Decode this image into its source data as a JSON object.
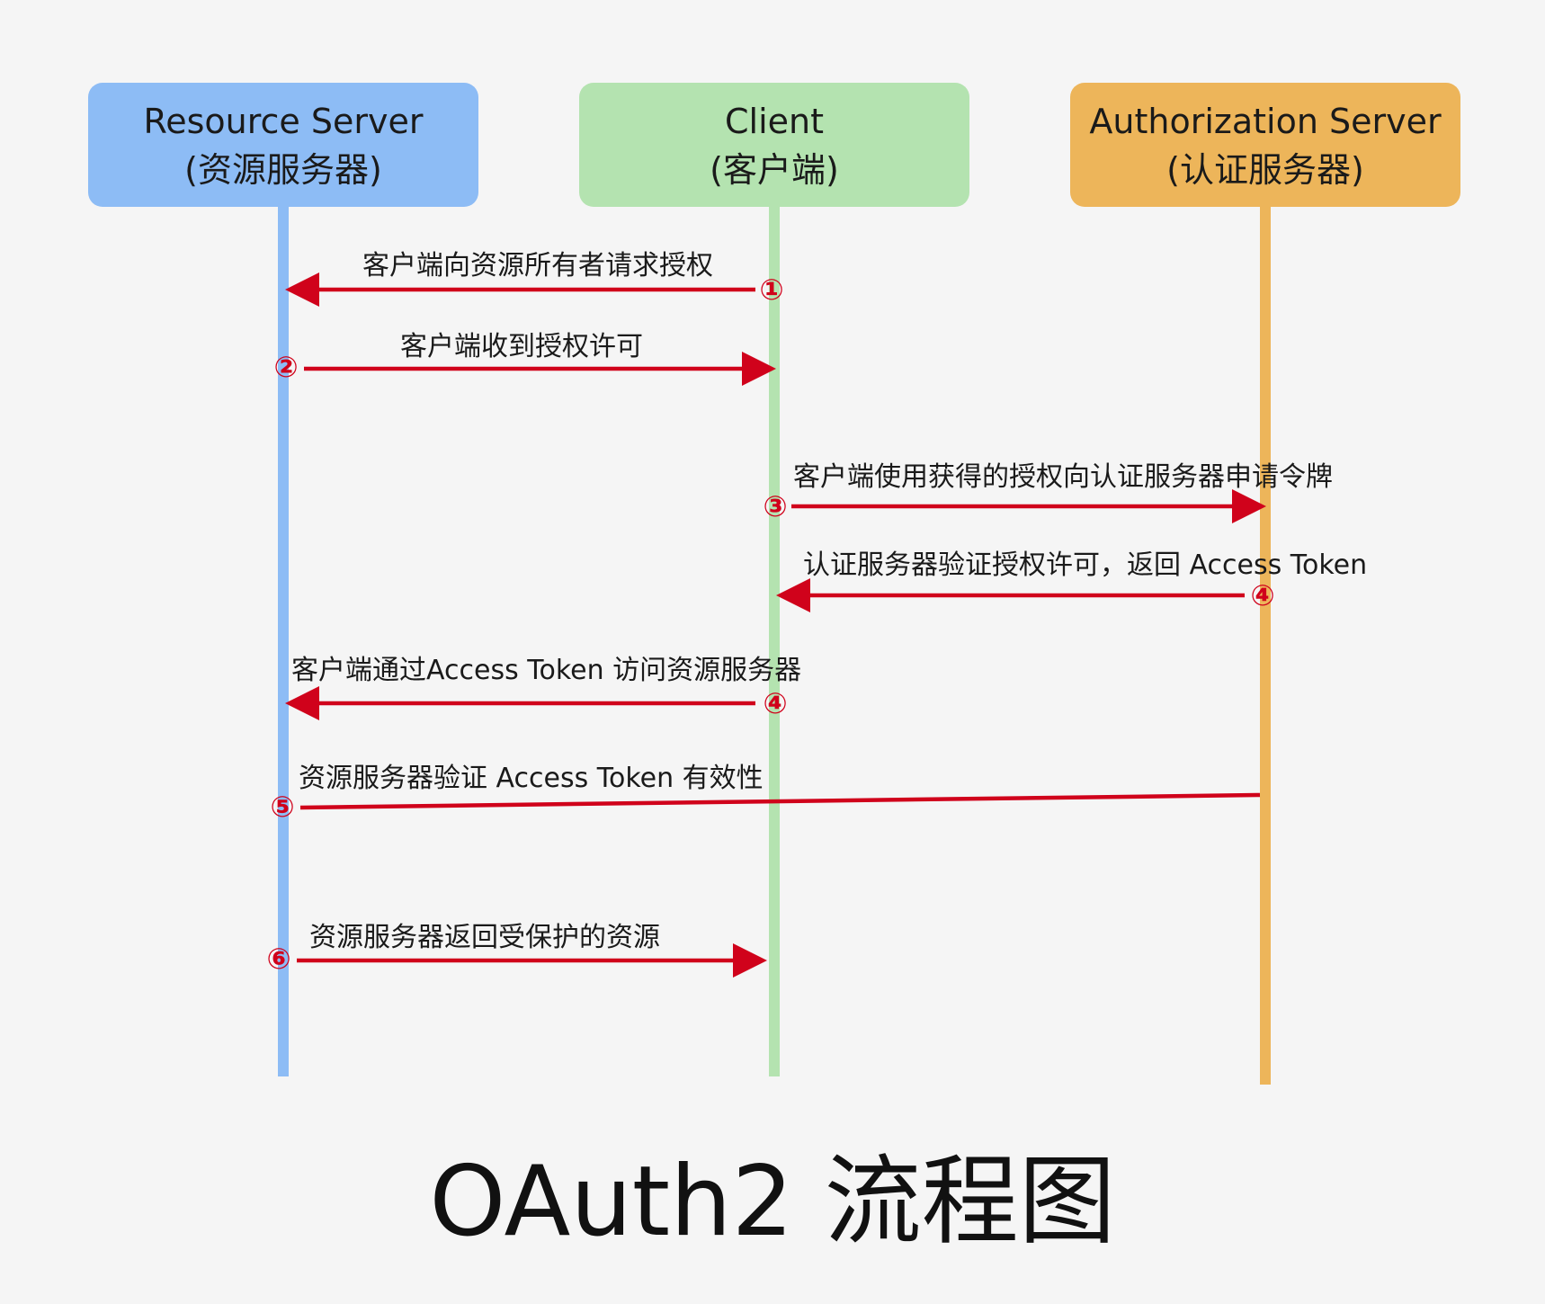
{
  "actors": [
    {
      "id": "resource",
      "name": "Resource Server",
      "sub": "(资源服务器)",
      "color": "#8dbcf5"
    },
    {
      "id": "client",
      "name": "Client",
      "sub": "(客户端)",
      "color": "#b4e3b0"
    },
    {
      "id": "auth",
      "name": "Authorization Server",
      "sub": "(认证服务器)",
      "color": "#edb55a"
    }
  ],
  "arrow_color": "#d0021b",
  "messages": [
    {
      "step": "①",
      "label": "客户端向资源所有者请求授权",
      "from": "client",
      "to": "resource",
      "arrowhead": true
    },
    {
      "step": "②",
      "label": "客户端收到授权许可",
      "from": "resource",
      "to": "client",
      "arrowhead": true
    },
    {
      "step": "③",
      "label": "客户端使用获得的授权向认证服务器申请令牌",
      "from": "client",
      "to": "auth",
      "arrowhead": true
    },
    {
      "step": "④",
      "label": "认证服务器验证授权许可，返回 Access Token",
      "from": "auth",
      "to": "client",
      "arrowhead": true
    },
    {
      "step": "④",
      "label": "客户端通过Access Token 访问资源服务器",
      "from": "client",
      "to": "resource",
      "arrowhead": true
    },
    {
      "step": "⑤",
      "label": "资源服务器验证 Access Token 有效性",
      "from": "auth",
      "to": "resource",
      "arrowhead": false
    },
    {
      "step": "⑥",
      "label": "资源服务器返回受保护的资源",
      "from": "resource",
      "to": "client",
      "arrowhead": true
    }
  ],
  "title": "OAuth2 流程图"
}
